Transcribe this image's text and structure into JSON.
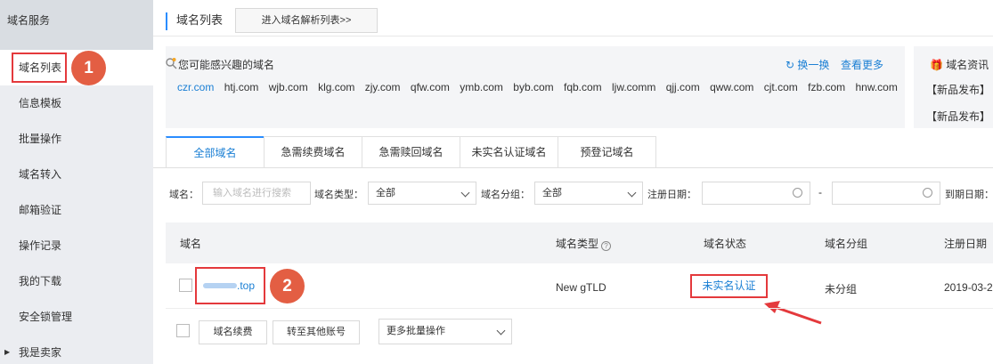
{
  "sidebar": {
    "header": "域名服务",
    "items": [
      {
        "label": "域名列表"
      },
      {
        "label": "信息模板"
      },
      {
        "label": "批量操作"
      },
      {
        "label": "域名转入"
      },
      {
        "label": "邮箱验证"
      },
      {
        "label": "操作记录"
      },
      {
        "label": "我的下载"
      },
      {
        "label": "安全锁管理"
      },
      {
        "label": "我是卖家"
      }
    ]
  },
  "badges": {
    "one": "1",
    "two": "2"
  },
  "header": {
    "title": "域名列表",
    "enter_button": "进入域名解析列表>>"
  },
  "suggestions": {
    "title": "您可能感兴趣的域名",
    "refresh": "换一换",
    "more": "查看更多",
    "domains": [
      "czr.com",
      "htj.com",
      "wjb.com",
      "klg.com",
      "zjy.com",
      "qfw.com",
      "ymb.com",
      "byb.com",
      "fqb.com",
      "ljw.comm",
      "qjj.com",
      "qww.com",
      "cjt.com",
      "fzb.com",
      "hnw.com"
    ]
  },
  "news": {
    "title": "域名资讯",
    "line1": "【新品发布】",
    "line2": "【新品发布】"
  },
  "tabs": [
    "全部域名",
    "急需续费域名",
    "急需赎回域名",
    "未实名认证域名",
    "预登记域名"
  ],
  "filters": {
    "domain_label": "域名：",
    "domain_placeholder": "输入域名进行搜索",
    "type_label": "域名类型：",
    "type_value": "全部",
    "group_label": "域名分组：",
    "group_value": "全部",
    "reg_date_label": "注册日期：",
    "date_sep": "-",
    "expire_label": "到期日期："
  },
  "table": {
    "columns": {
      "domain": "域名",
      "type": "域名类型",
      "status": "域名状态",
      "group": "域名分组",
      "reg_date": "注册日期"
    },
    "rows": [
      {
        "domain_suffix": ".top",
        "type": "New gTLD",
        "status": "未实名认证",
        "group": "未分组",
        "reg_date": "2019-03-2"
      }
    ]
  },
  "actions": {
    "renew": "域名续费",
    "transfer": "转至其他账号",
    "more_batch": "更多批量操作"
  },
  "colors": {
    "accent": "#1a7fd4",
    "highlight": "#e4393c",
    "badge": "#e35e43"
  }
}
